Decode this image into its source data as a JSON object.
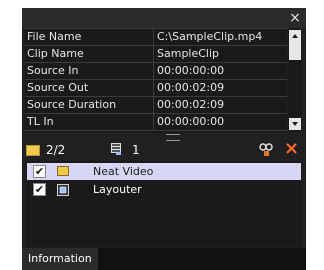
{
  "window": {
    "close_glyph": "×"
  },
  "properties": {
    "rows": [
      {
        "key": "File Name",
        "value": "C:\\SampleClip.mp4"
      },
      {
        "key": "Clip Name",
        "value": "SampleClip"
      },
      {
        "key": "Source In",
        "value": "00:00:00:00"
      },
      {
        "key": "Source Out",
        "value": "00:00:02:09"
      },
      {
        "key": "Source Duration",
        "value": "00:00:02:09"
      },
      {
        "key": "TL In",
        "value": "00:00:00:00"
      }
    ]
  },
  "toolbar": {
    "clip_count": "2/2",
    "filter_count": "1",
    "delete_glyph": "×"
  },
  "filters": {
    "items": [
      {
        "label": "Neat Video",
        "checked": true,
        "selected": true,
        "icon": "clip-icon"
      },
      {
        "label": "Layouter",
        "checked": true,
        "selected": false,
        "icon": "layouter-icon"
      }
    ]
  },
  "tabs": {
    "information": "Information"
  },
  "colors": {
    "panel": "#202020",
    "selected_row": "#d7d7f5",
    "delete_accent": "#ff6a2a",
    "clip_icon": "#f2c94c"
  }
}
